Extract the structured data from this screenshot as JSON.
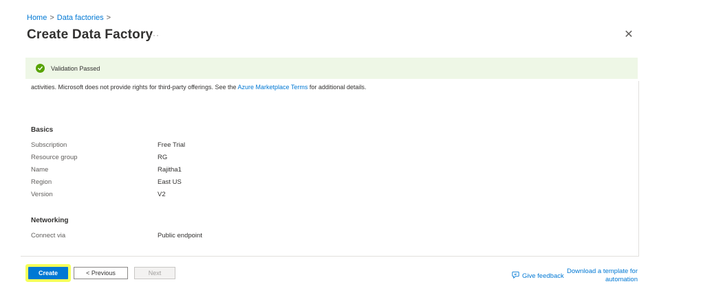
{
  "breadcrumb": {
    "home": "Home",
    "sep": ">",
    "data_factories": "Data factories"
  },
  "page": {
    "title": "Create Data Factory",
    "more": "···",
    "close": "✕"
  },
  "banner": {
    "text": "Validation Passed",
    "color": "#57a300"
  },
  "terms": {
    "text_before": "activities. Microsoft does not provide rights for third-party offerings. See the ",
    "link": "Azure Marketplace Terms",
    "text_after": " for additional details."
  },
  "basics": {
    "heading": "Basics",
    "rows": [
      {
        "label": "Subscription",
        "value": "Free Trial"
      },
      {
        "label": "Resource group",
        "value": "RG"
      },
      {
        "label": "Name",
        "value": "Rajitha1"
      },
      {
        "label": "Region",
        "value": "East US"
      },
      {
        "label": "Version",
        "value": "V2"
      }
    ]
  },
  "networking": {
    "heading": "Networking",
    "rows": [
      {
        "label": "Connect via",
        "value": "Public endpoint"
      }
    ]
  },
  "footer": {
    "create": "Create",
    "previous": "< Previous",
    "next": "Next",
    "feedback": "Give feedback",
    "download": "Download a template for automation"
  },
  "colors": {
    "accent": "#0078d4",
    "highlight": "#eeff00"
  }
}
